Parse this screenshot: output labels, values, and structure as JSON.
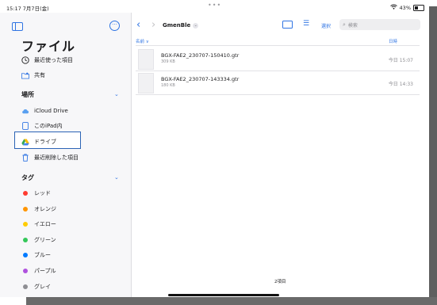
{
  "status_bar": {
    "time": "15:17 7月7日(金)",
    "center": "•••",
    "battery": "43%"
  },
  "sidebar": {
    "title": "ファイル",
    "top_items": [
      {
        "label": "最近使った項目",
        "icon": "clock-icon"
      },
      {
        "label": "共有",
        "icon": "shared-folder-icon"
      }
    ],
    "locations_header": "場所",
    "locations": [
      {
        "label": "iCloud Drive",
        "icon": "cloud-icon"
      },
      {
        "label": "このiPad内",
        "icon": "ipad-icon",
        "selected": true
      },
      {
        "label": "ドライブ",
        "icon": "drive-icon"
      },
      {
        "label": "最近削除した項目",
        "icon": "trash-icon"
      }
    ],
    "tags_header": "タグ",
    "tags": [
      {
        "label": "レッド",
        "color": "#ff3b30"
      },
      {
        "label": "オレンジ",
        "color": "#ff9500"
      },
      {
        "label": "イエロー",
        "color": "#ffcc00"
      },
      {
        "label": "グリーン",
        "color": "#34c759"
      },
      {
        "label": "ブルー",
        "color": "#007aff"
      },
      {
        "label": "パープル",
        "color": "#af52de"
      },
      {
        "label": "グレイ",
        "color": "#8e8e93"
      }
    ]
  },
  "main": {
    "folder_title": "GmenBle",
    "select_label": "選択",
    "search_placeholder": "検索",
    "col_name": "名前 ∨",
    "col_date": "日時",
    "files": [
      {
        "name": "BGX-FAE2_230707-150410.gtr",
        "size": "309 KB",
        "date": "今日 15:07"
      },
      {
        "name": "BGX-FAE2_230707-143334.gtr",
        "size": "180 KB",
        "date": "今日 14:33"
      }
    ],
    "item_count": "2項目"
  },
  "colors": {
    "accent": "#2f74e3",
    "selection_border": "#2b63b5"
  }
}
